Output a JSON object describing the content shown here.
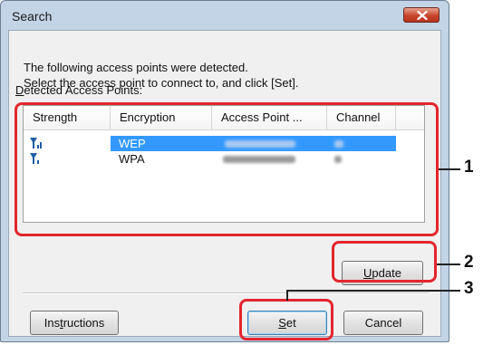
{
  "window": {
    "title": "Search"
  },
  "message": {
    "line1": "The following access points were detected.",
    "line2": "Select the access point to connect to, and click [Set]."
  },
  "list": {
    "label_prefix": "D",
    "label_rest": "etected Access Points:",
    "columns": [
      "Strength",
      "Encryption",
      "Access Point ...",
      "Channel"
    ],
    "rows": [
      {
        "signal_icon": "wifi-signal-icon",
        "encryption": "WEP",
        "selected": true
      },
      {
        "signal_icon": "wifi-signal-icon",
        "encryption": "WPA",
        "selected": false
      }
    ]
  },
  "buttons": {
    "update_u": "U",
    "update_rest": "pdate",
    "instructions_pre": "Ins",
    "instructions_u": "t",
    "instructions_post": "ructions",
    "set_u": "S",
    "set_rest": "et",
    "cancel": "Cancel"
  },
  "callouts": [
    "1",
    "2",
    "3"
  ],
  "colors": {
    "selection": "#3399ff",
    "highlight": "#e3262e",
    "signal_icon": "#1f5fa8"
  }
}
